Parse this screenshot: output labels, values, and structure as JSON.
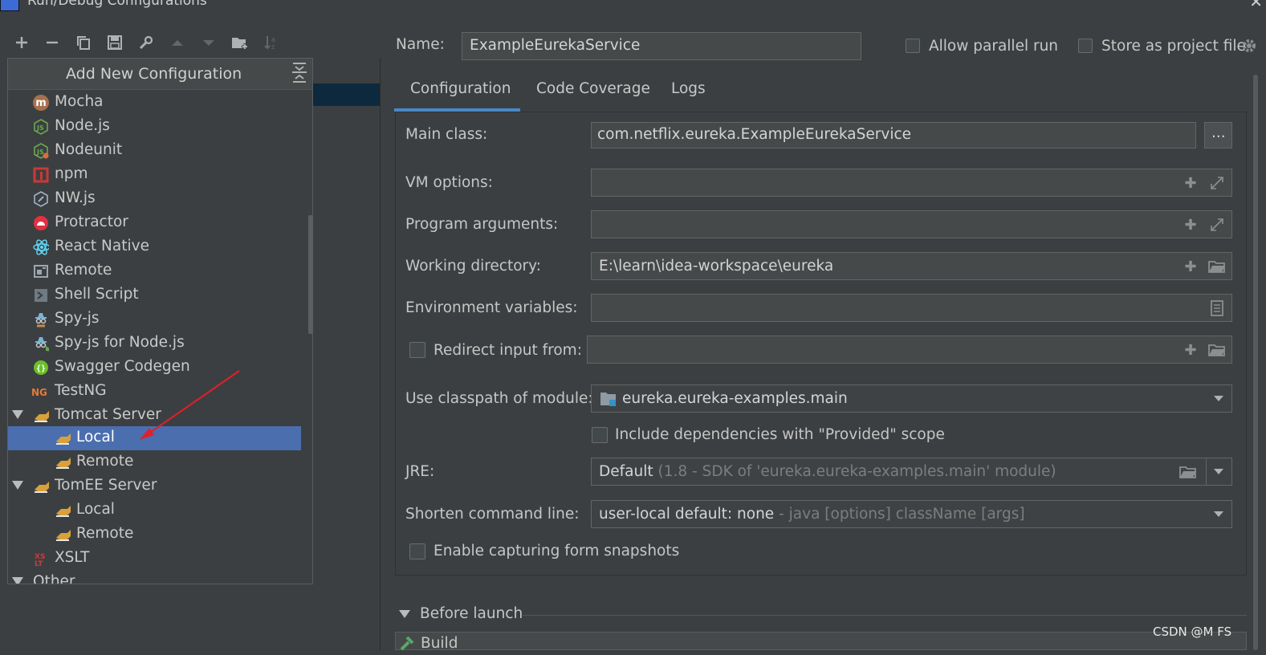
{
  "window": {
    "title": "Run/Debug Configurations"
  },
  "toolbar": {
    "items": [
      "add-icon",
      "remove-icon",
      "copy-icon",
      "save-icon",
      "wrench-icon",
      "move-up-icon",
      "move-down-icon",
      "new-folder-icon",
      "sort-icon"
    ]
  },
  "popup": {
    "title": "Add New Configuration",
    "items": [
      {
        "label": "Mocha",
        "icon": "mocha-icon",
        "color": "#b7714c",
        "glyph": "m"
      },
      {
        "label": "Node.js",
        "icon": "nodejs-icon",
        "color": "#6aa84f",
        "glyph": "js"
      },
      {
        "label": "Nodeunit",
        "icon": "nodeunit-icon",
        "color": "#6aa84f",
        "glyph": "js"
      },
      {
        "label": "npm",
        "icon": "npm-icon",
        "color": "#cb3837",
        "glyph": ""
      },
      {
        "label": "NW.js",
        "icon": "nwjs-icon",
        "color": "#9fb3c8",
        "glyph": ""
      },
      {
        "label": "Protractor",
        "icon": "protractor-icon",
        "color": "#e03140",
        "glyph": ""
      },
      {
        "label": "React Native",
        "icon": "react-icon",
        "color": "#61dafb",
        "glyph": ""
      },
      {
        "label": "Remote",
        "icon": "remote-icon",
        "color": "#9aa7b0",
        "glyph": ""
      },
      {
        "label": "Shell Script",
        "icon": "shell-script-icon",
        "color": "#9aa7b0",
        "glyph": ""
      },
      {
        "label": "Spy-js",
        "icon": "spyjs-icon",
        "color": "#7ab4d8",
        "glyph": ""
      },
      {
        "label": "Spy-js for Node.js",
        "icon": "spyjs-node-icon",
        "color": "#7ab4d8",
        "glyph": ""
      },
      {
        "label": "Swagger Codegen",
        "icon": "swagger-icon",
        "color": "#85ea2d",
        "glyph": ""
      },
      {
        "label": "TestNG",
        "icon": "testng-icon",
        "color": "#e07b39",
        "glyph": "NG"
      },
      {
        "label": "Tomcat Server",
        "icon": "tomcat-icon",
        "color": "#d8a13a",
        "glyph": ""
      },
      {
        "label": "Local",
        "icon": "tomcat-icon",
        "color": "#d8a13a",
        "glyph": ""
      },
      {
        "label": "Remote",
        "icon": "tomcat-icon",
        "color": "#d8a13a",
        "glyph": ""
      },
      {
        "label": "TomEE Server",
        "icon": "tomee-icon",
        "color": "#d8a13a",
        "glyph": ""
      },
      {
        "label": "Local",
        "icon": "tomee-icon",
        "color": "#d8a13a",
        "glyph": ""
      },
      {
        "label": "Remote",
        "icon": "tomee-icon",
        "color": "#d8a13a",
        "glyph": ""
      },
      {
        "label": "XSLT",
        "icon": "xslt-icon",
        "color": "#c93b3b",
        "glyph": "X"
      },
      {
        "label": "Other",
        "icon": "",
        "color": "",
        "glyph": ""
      }
    ]
  },
  "header": {
    "name_label": "Name:",
    "name_value": "ExampleEurekaService",
    "allow_parallel_label": "Allow parallel run",
    "store_project_label": "Store as project file"
  },
  "tabs": [
    {
      "label": "Configuration",
      "active": true
    },
    {
      "label": "Code Coverage",
      "active": false
    },
    {
      "label": "Logs",
      "active": false
    }
  ],
  "config": {
    "main_class_label": "Main class:",
    "main_class_value": "com.netflix.eureka.ExampleEurekaService",
    "main_class_button": "...",
    "vm_options_label": "VM options:",
    "program_args_label": "Program arguments:",
    "working_dir_label": "Working directory:",
    "working_dir_value": "E:\\learn\\idea-workspace\\eureka",
    "env_vars_label": "Environment variables:",
    "redirect_label": "Redirect input from:",
    "classpath_label": "Use classpath of module:",
    "classpath_value": "eureka.eureka-examples.main",
    "include_deps_label": "Include dependencies with \"Provided\" scope",
    "jre_label": "JRE:",
    "jre_value": "Default",
    "jre_hint": "(1.8 - SDK of 'eureka.eureka-examples.main' module)",
    "shorten_label": "Shorten command line:",
    "shorten_value": "user-local default: none",
    "shorten_hint": "- java [options] className [args]",
    "snapshots_label": "Enable capturing form snapshots"
  },
  "before_launch": {
    "label": "Before launch",
    "build_label": "Build"
  },
  "watermark": "CSDN @M FS",
  "colors": {
    "selection": "#4b6eaf",
    "tab_underline": "#4a88c7",
    "annotation_arrow": "#e0202a"
  }
}
